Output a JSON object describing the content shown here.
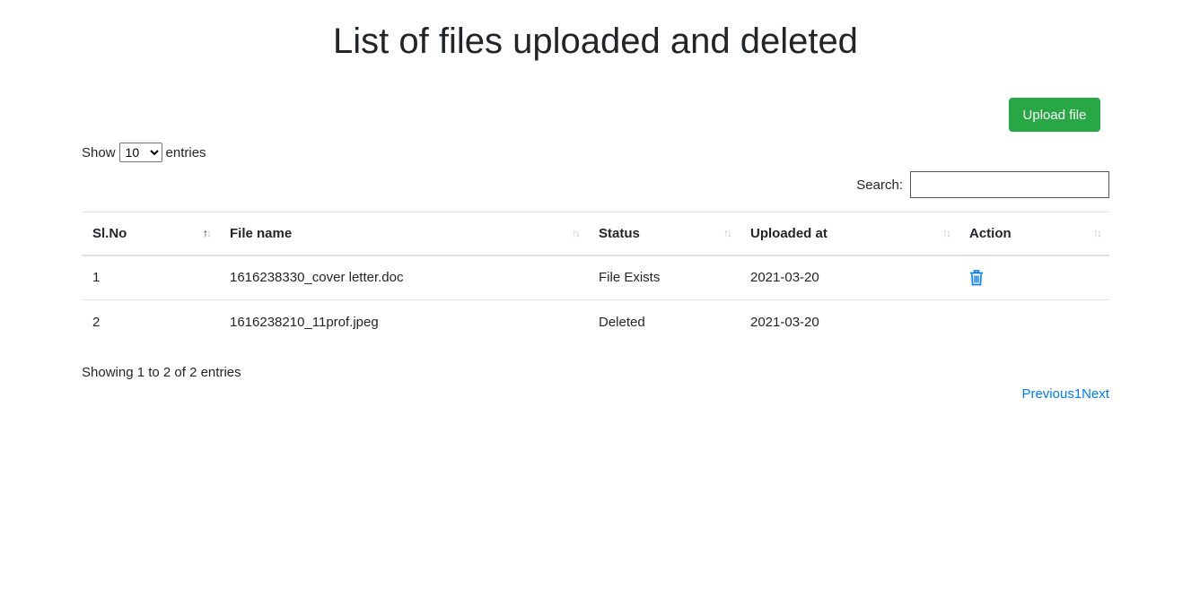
{
  "page": {
    "title": "List of files uploaded and deleted"
  },
  "toolbar": {
    "upload_label": "Upload file"
  },
  "length": {
    "prefix": "Show",
    "selected": "10",
    "suffix": "entries"
  },
  "search": {
    "label": "Search:",
    "value": ""
  },
  "table": {
    "columns": [
      "Sl.No",
      "File name",
      "Status",
      "Uploaded at",
      "Action"
    ],
    "rows": [
      {
        "slno": "1",
        "file_name": "1616238330_cover letter.doc",
        "status": "File Exists",
        "uploaded_at": "2021-03-20",
        "action": "trash-icon"
      },
      {
        "slno": "2",
        "file_name": "1616238210_11prof.jpeg",
        "status": "Deleted",
        "uploaded_at": "2021-03-20",
        "action": ""
      }
    ]
  },
  "info": {
    "text": "Showing 1 to 2 of 2 entries"
  },
  "pagination": {
    "previous": "Previous",
    "page": "1",
    "next": "Next"
  },
  "colors": {
    "upload_button": "#28a745",
    "link": "#007bff",
    "icon": "#007bff"
  }
}
